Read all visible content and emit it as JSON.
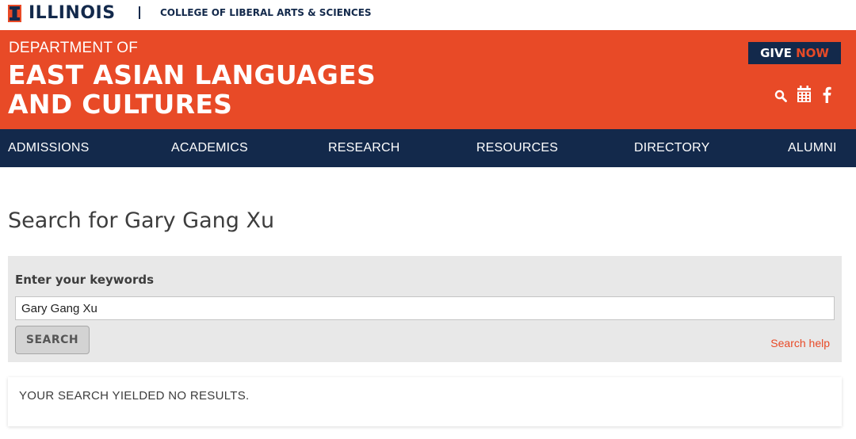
{
  "brand": {
    "logo_icon": "block-i-logo",
    "wordmark": "ILLINOIS",
    "separator": "|",
    "college": "COLLEGE OF LIBERAL ARTS & SCIENCES"
  },
  "header": {
    "dept_prefix": "DEPARTMENT OF",
    "dept_line1": "EAST ASIAN LANGUAGES",
    "dept_line2": "AND CULTURES",
    "give_label": "GIVE",
    "give_now": "NOW",
    "icons": [
      "search-icon",
      "calendar-icon",
      "facebook-icon"
    ],
    "colors": {
      "orange": "#e84a27",
      "navy": "#13294b"
    }
  },
  "nav": {
    "items": [
      {
        "label": "ADMISSIONS"
      },
      {
        "label": "ACADEMICS"
      },
      {
        "label": "RESEARCH"
      },
      {
        "label": "RESOURCES"
      },
      {
        "label": "DIRECTORY"
      },
      {
        "label": "ALUMNI"
      }
    ]
  },
  "main": {
    "title": "Search for Gary Gang Xu",
    "search": {
      "label": "Enter your keywords",
      "value": "Gary Gang Xu",
      "button": "SEARCH",
      "help": "Search help"
    },
    "results_message": "YOUR SEARCH YIELDED NO RESULTS."
  }
}
